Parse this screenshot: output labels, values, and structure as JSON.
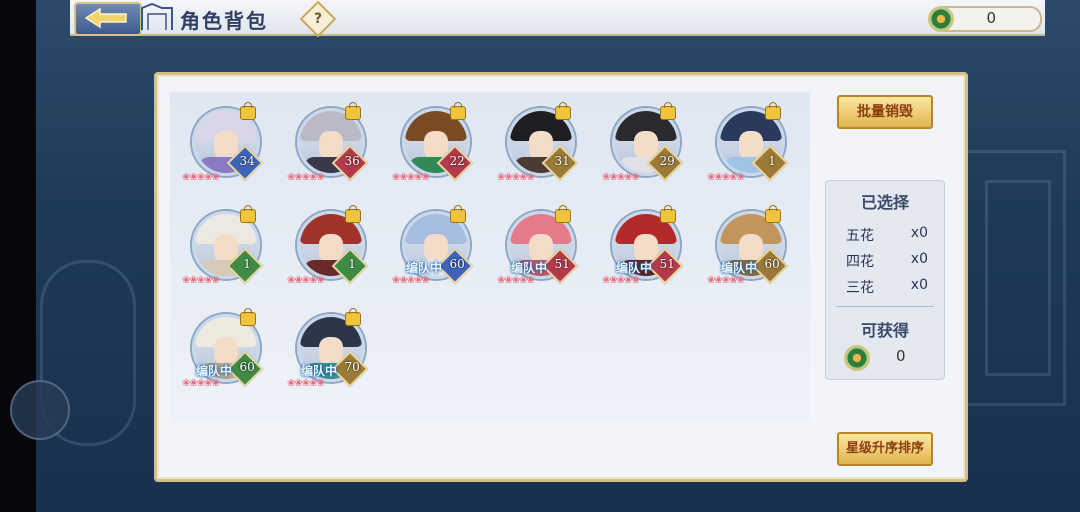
{
  "header": {
    "title": "角色背包",
    "help_label": "?",
    "currency_value": "0"
  },
  "actions": {
    "batch_sell": "批量销毁",
    "sort": "星级升序排序"
  },
  "selection": {
    "title": "已选择",
    "rows": [
      {
        "label": "五花",
        "count": "x0"
      },
      {
        "label": "四花",
        "count": "x0"
      },
      {
        "label": "三花",
        "count": "x0"
      }
    ],
    "gain_title": "可获得",
    "gain_value": "0"
  },
  "team_label": "编队中",
  "characters": [
    {
      "level": "34",
      "in_team": false,
      "badge": "#3e63b8",
      "hair": "#d9d6e8",
      "robe": "#8a7ac4"
    },
    {
      "level": "36",
      "in_team": false,
      "badge": "#b23a4a",
      "hair": "#b9bac6",
      "robe": "#38394a"
    },
    {
      "level": "22",
      "in_team": false,
      "badge": "#b23a4a",
      "hair": "#7a4a25",
      "robe": "#2f8a58"
    },
    {
      "level": "31",
      "in_team": false,
      "badge": "#9a7a36",
      "hair": "#1d1d22",
      "robe": "#4a3b34"
    },
    {
      "level": "29",
      "in_team": false,
      "badge": "#9a7a36",
      "hair": "#2a2a2e",
      "robe": "#e0e0e6"
    },
    {
      "level": "1",
      "in_team": false,
      "badge": "#9a7a36",
      "hair": "#2b3a5c",
      "robe": "#9fc4e6"
    },
    {
      "level": "1",
      "in_team": false,
      "badge": "#3f8a45",
      "hair": "#ece8e2",
      "robe": "#d7c9b8"
    },
    {
      "level": "1",
      "in_team": false,
      "badge": "#3f8a45",
      "hair": "#a0322a",
      "robe": "#6a2a2a"
    },
    {
      "level": "60",
      "in_team": true,
      "badge": "#3e63b8",
      "hair": "#a6bde0",
      "robe": "#dfe8f4"
    },
    {
      "level": "51",
      "in_team": true,
      "badge": "#b23a4a",
      "hair": "#e47a8a",
      "robe": "#c4566a"
    },
    {
      "level": "51",
      "in_team": true,
      "badge": "#b23a4a",
      "hair": "#b42a2a",
      "robe": "#5a2424"
    },
    {
      "level": "60",
      "in_team": true,
      "badge": "#9a7a36",
      "hair": "#c2955a",
      "robe": "#8a6a3a"
    },
    {
      "level": "60",
      "in_team": true,
      "badge": "#3f8a45",
      "hair": "#eeeae0",
      "robe": "#b8a98a"
    },
    {
      "level": "70",
      "in_team": true,
      "badge": "#9a7a36",
      "hair": "#2b3648",
      "robe": "#3a8f8a"
    }
  ]
}
